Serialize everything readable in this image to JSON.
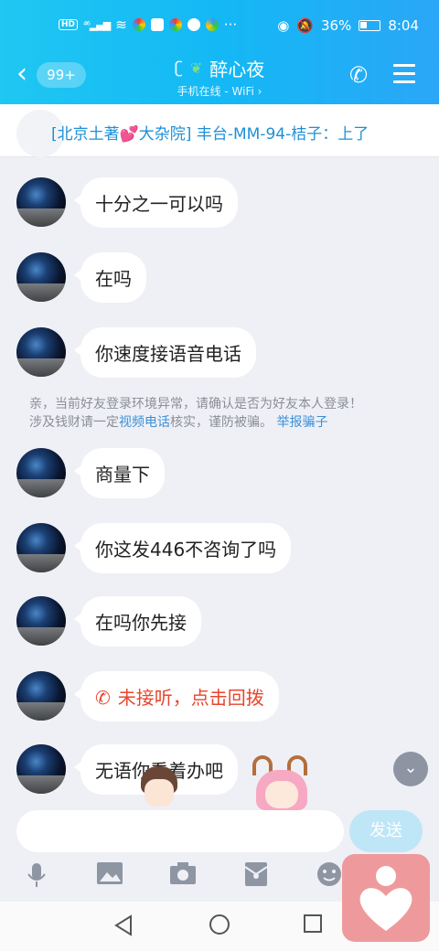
{
  "status_bar": {
    "left_icons": [
      "hd-icon",
      "signal-icon",
      "wifi-icon",
      "app-icon",
      "chat-icon",
      "app-icon",
      "app-icon",
      "app-icon"
    ],
    "more": "···",
    "battery_text": "36%",
    "time": "8:04"
  },
  "header": {
    "unread_count": "99+",
    "name": "醉心夜",
    "subtitle": "手机在线 - WiFi",
    "subtitle_arrow": "›"
  },
  "notice": {
    "text": "[北京土著💕大杂院] 丰台-MM-94-桔子：上了"
  },
  "messages": [
    {
      "text": "十分之一可以吗"
    },
    {
      "text": "在吗"
    },
    {
      "text": "你速度接语音电话"
    },
    {
      "text": "商量下"
    },
    {
      "text": "你这发446不咨询了吗"
    },
    {
      "text": "在吗你先接"
    },
    {
      "text": "未接听，点击回拨",
      "type": "missed_call"
    },
    {
      "text": "无语你看着办吧"
    }
  ],
  "warning": {
    "line1": "亲，当前好友登录环境异常，请确认是否为好友本人登录！",
    "line2_pre": "涉及钱财请一定",
    "line2_link": "视频电话",
    "line2_mid": "核实，谨防被骗。",
    "line2_report": "举报骗子"
  },
  "input": {
    "placeholder": "",
    "send_label": "发送"
  },
  "colors": {
    "header_start": "#1fc7f2",
    "header_end": "#2aa7f7",
    "link": "#3b8fd8",
    "missed": "#e8462e",
    "floating": "#ee9a9d"
  }
}
